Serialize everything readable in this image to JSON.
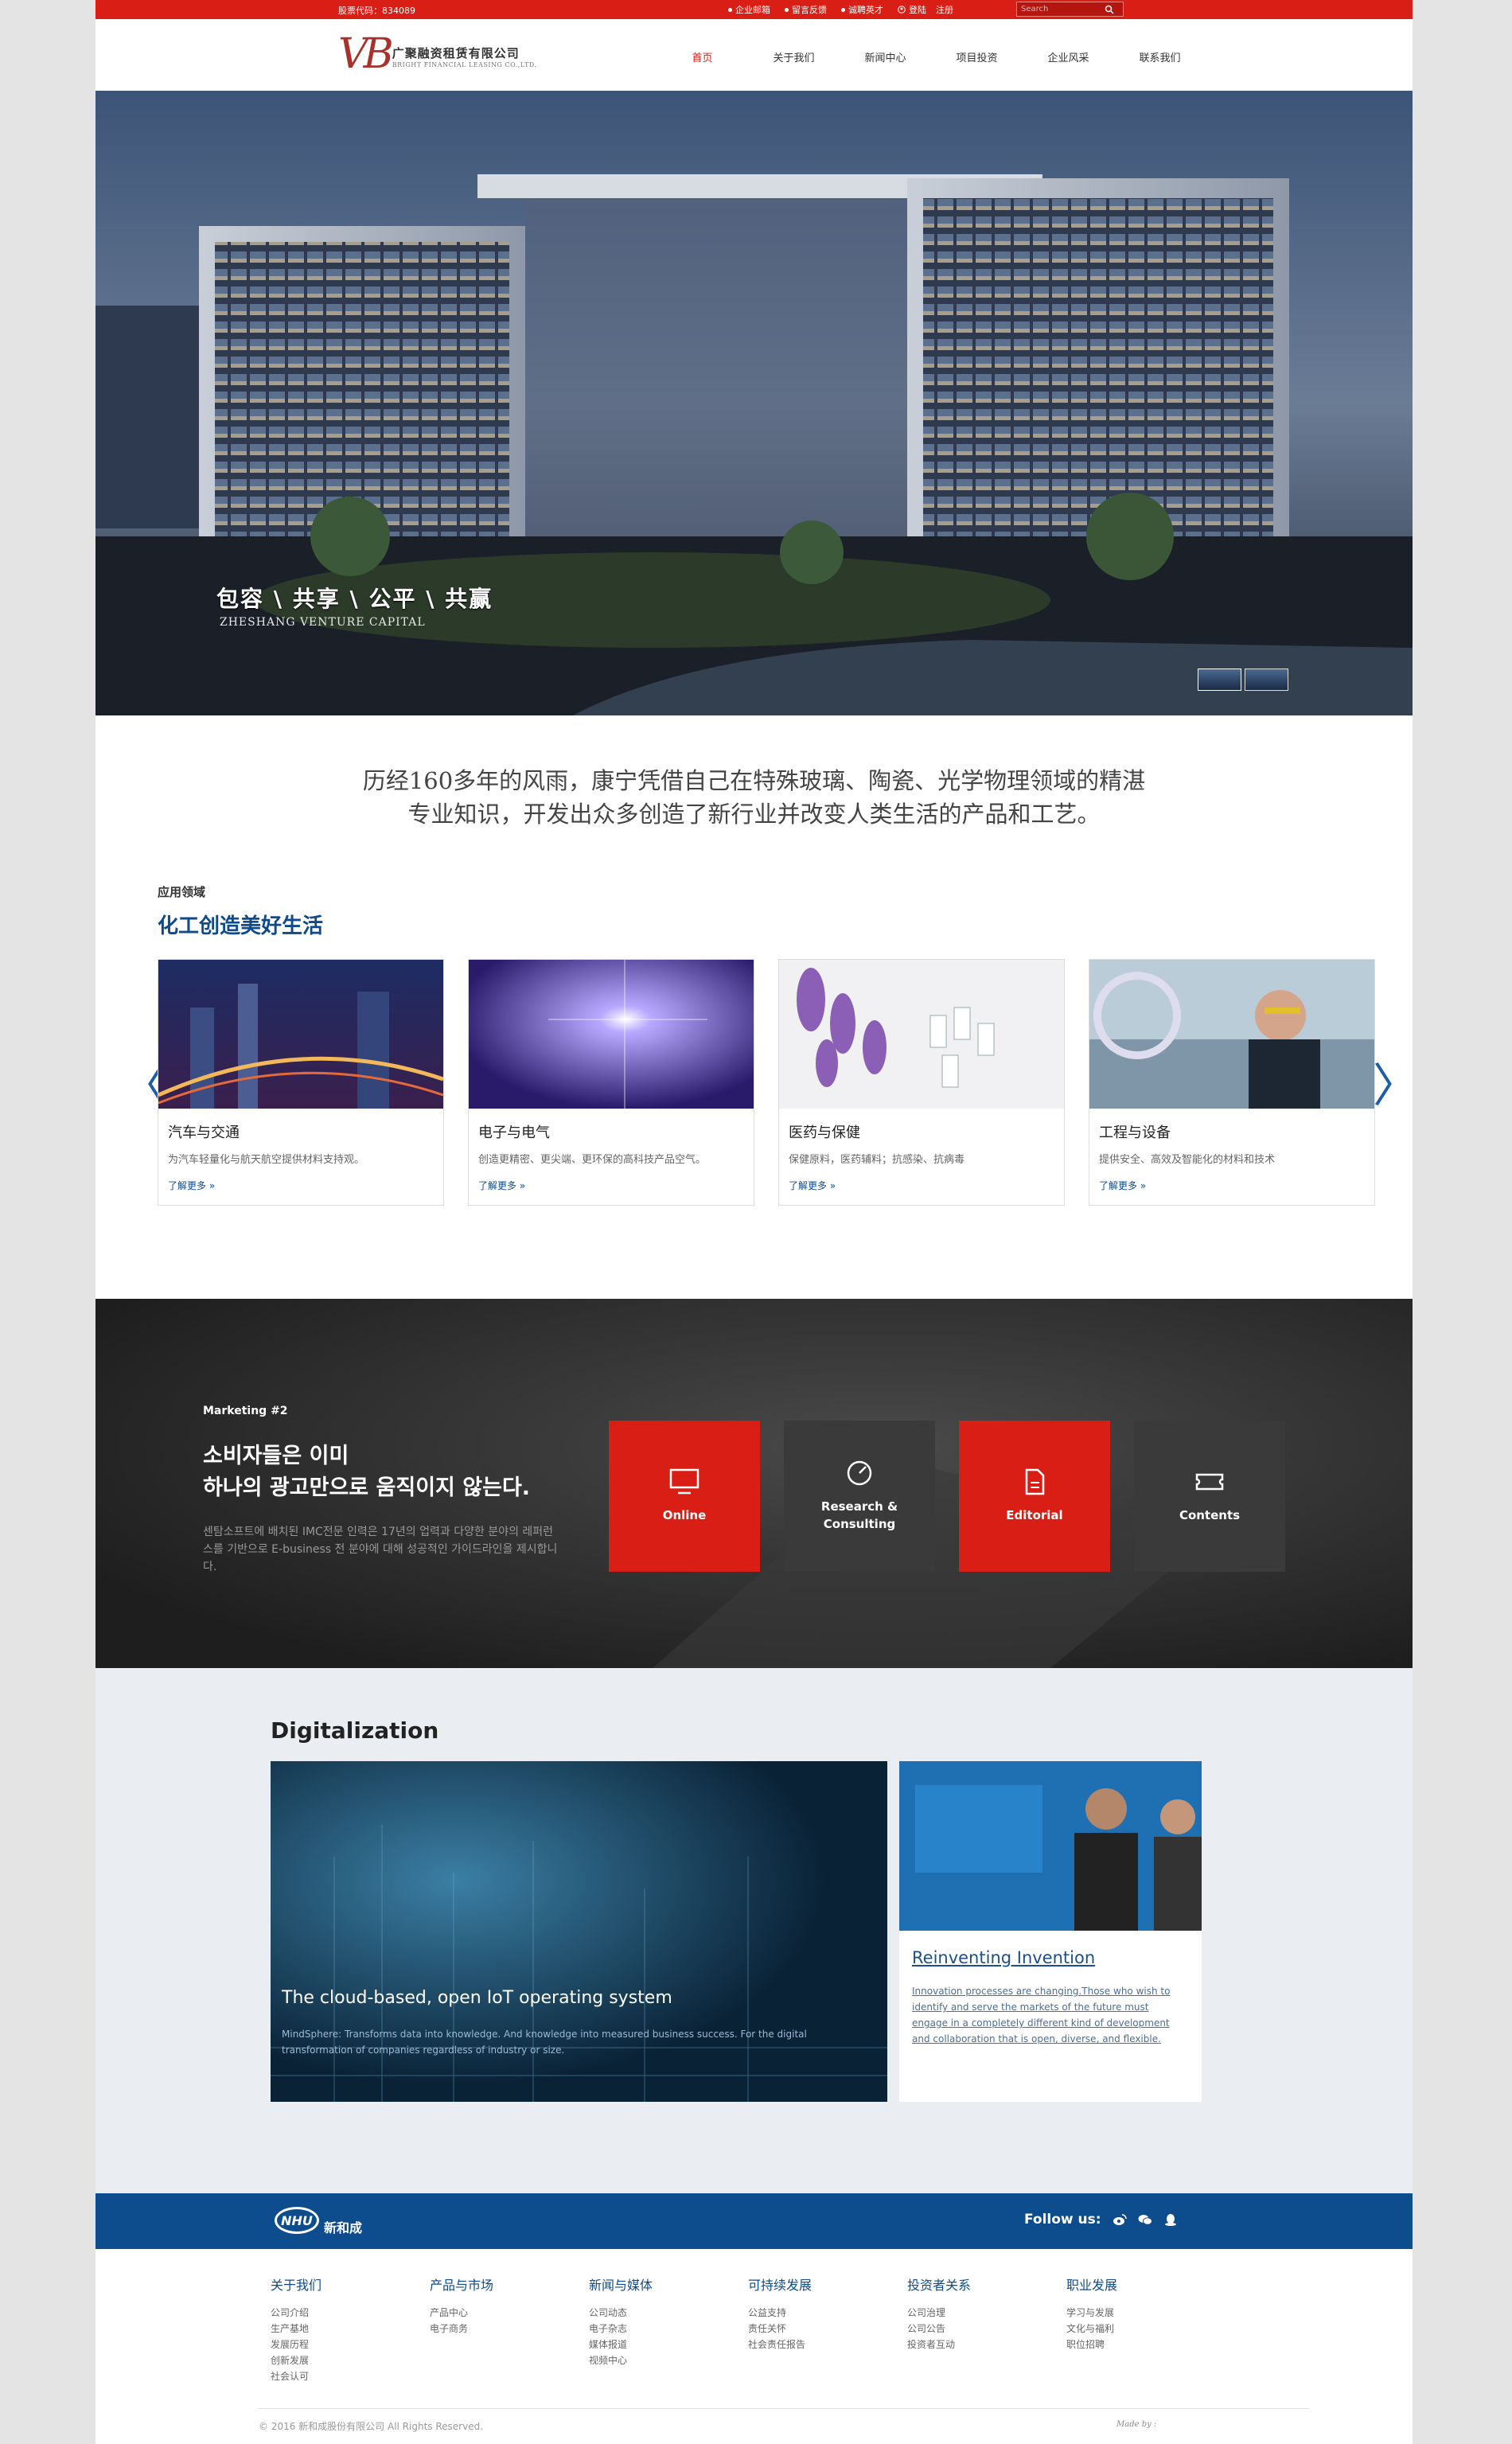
{
  "topbar": {
    "stock_code": "股票代码：834089",
    "links": [
      "企业邮箱",
      "留言反馈",
      "诚聘英才",
      "登陆",
      "注册"
    ],
    "search_placeholder": "Search"
  },
  "header": {
    "logo_cn": "广聚融资租赁有限公司",
    "logo_en": "BRIGHT FINANCIAL LEASING CO.,LTD.",
    "nav": [
      "首页",
      "关于我们",
      "新闻中心",
      "项目投资",
      "企业风采",
      "联系我们"
    ]
  },
  "hero": {
    "title": "包容 \\ 共享 \\ 公平 \\ 共赢",
    "subtitle": "ZHESHANG VENTURE CAPITAL"
  },
  "intro": {
    "line1": "历经160多年的风雨，康宁凭借自己在特殊玻璃、陶瓷、光学物理领域的精湛",
    "line2": "专业知识，开发出众多创造了新行业并改变人类生活的产品和工艺。"
  },
  "applications": {
    "kicker": "应用领域",
    "title": "化工创造美好生活",
    "prev_arrow": "〈",
    "next_arrow": "〉",
    "cards": [
      {
        "title": "汽车与交通",
        "desc": "为汽车轻量化与航天航空提供材料支持观。",
        "more": "了解更多 »"
      },
      {
        "title": "电子与电气",
        "desc": "创造更精密、更尖端、更环保的高科技产品空气。",
        "more": "了解更多 »"
      },
      {
        "title": "医药与保健",
        "desc": "保健原料，医药辅料；抗感染、抗病毒",
        "more": "了解更多 »"
      },
      {
        "title": "工程与设备",
        "desc": "提供安全、高效及智能化的材料和技术",
        "more": "了解更多 »"
      }
    ]
  },
  "marketing": {
    "label": "Marketing #2",
    "title_line1": "소비자들은 이미",
    "title_line2": "하나의 광고만으로 움직이지 않는다.",
    "body": "센탐소프트에 배치된 IMC전문 인력은 17년의 업력과 다양한 분야의 레퍼런스를 기반으로 E-business 전 분야에 대해 성공적인 가이드라인을 제시합니다.",
    "tiles": [
      {
        "label": "Online",
        "icon": "monitor-icon",
        "color": "#d81e15"
      },
      {
        "label": "Research &\nConsulting",
        "icon": "gauge-icon",
        "color": "#3a3a3a"
      },
      {
        "label": "Editorial",
        "icon": "document-icon",
        "color": "#d81e15"
      },
      {
        "label": "Contents",
        "icon": "ticket-icon",
        "color": "#3a3a3a"
      }
    ]
  },
  "digitalization": {
    "title": "Digitalization",
    "main_heading": "The cloud-based, open IoT operating system",
    "main_body": "MindSphere: Transforms data into knowledge. And knowledge into measured business success. For the digital transformation of companies regardless of industry or size.",
    "side_heading": "Reinventing Invention",
    "side_body": "Innovation processes are changing.Those who wish to identify and serve the markets of the future must engage in a completely different kind of development and collaboration that is open, diverse, and flexible."
  },
  "footer": {
    "logo_badge": "NHU",
    "logo_name": "新和成",
    "follow": "Follow us:",
    "columns": [
      {
        "heading": "关于我们",
        "items": [
          "公司介绍",
          "生产基地",
          "发展历程",
          "创新发展",
          "社会认可"
        ]
      },
      {
        "heading": "产品与市场",
        "items": [
          "产品中心",
          "电子商务"
        ]
      },
      {
        "heading": "新闻与媒体",
        "items": [
          "公司动态",
          "电子杂志",
          "媒体报道",
          "视频中心"
        ]
      },
      {
        "heading": "可持续发展",
        "items": [
          "公益支持",
          "责任关怀",
          "社会责任报告"
        ]
      },
      {
        "heading": "投资者关系",
        "items": [
          "公司治理",
          "公司公告",
          "投资者互动"
        ]
      },
      {
        "heading": "职业发展",
        "items": [
          "学习与发展",
          "文化与福利",
          "职位招聘"
        ]
      }
    ],
    "copyright": "© 2016 新和成股份有限公司 All Rights Reserved.",
    "made_by": "Made by :"
  },
  "colors": {
    "brand_red": "#d81e15",
    "brand_blue": "#0d4d8e",
    "dark_band": "#2a2a2a"
  }
}
